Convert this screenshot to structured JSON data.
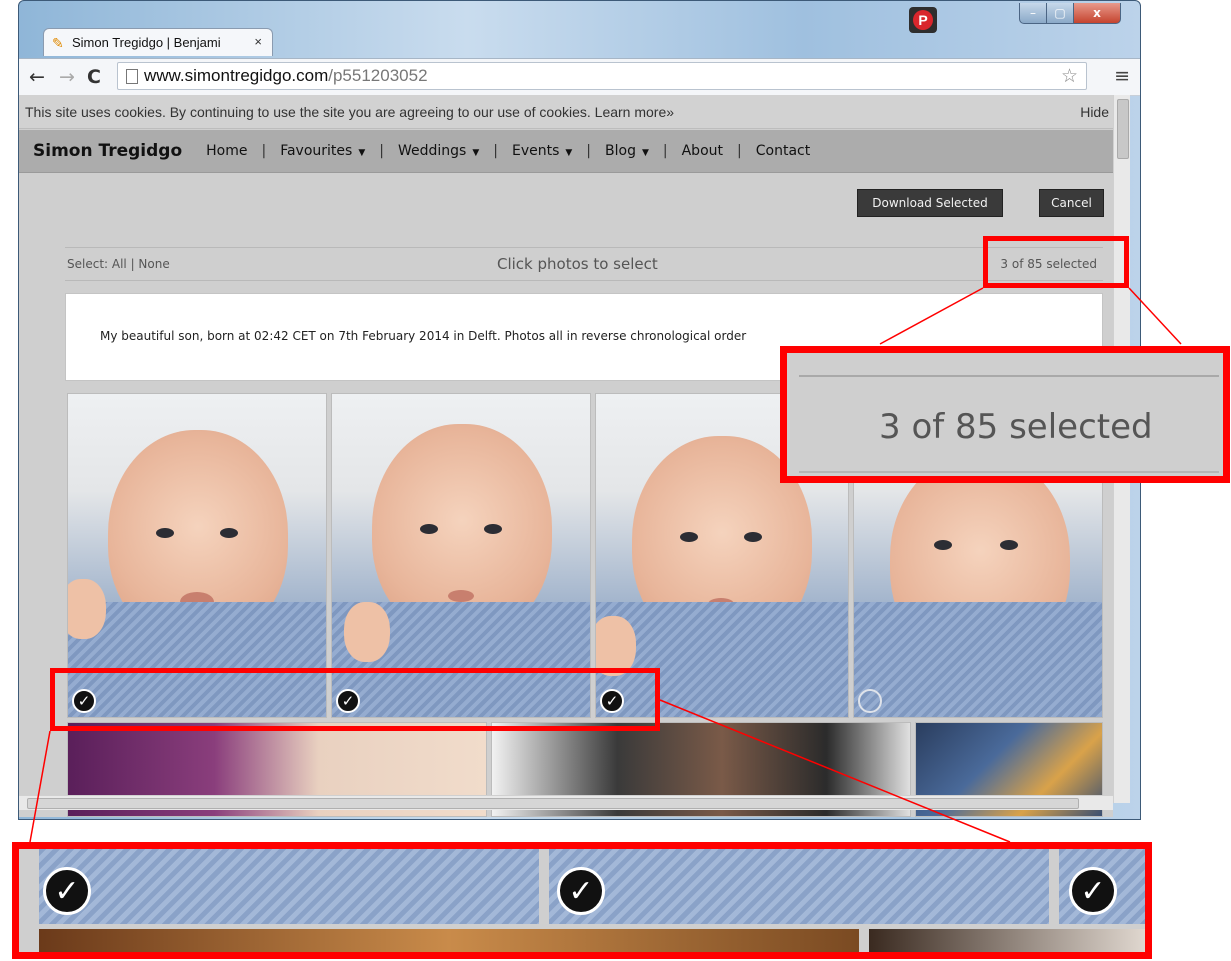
{
  "browser": {
    "tab_title": "Simon Tregidgo | Benjami",
    "tab_close": "×",
    "pin_badge": "P",
    "window_controls": {
      "minimize": "–",
      "maximize": "▢",
      "close": "x"
    },
    "nav": {
      "back": "←",
      "forward": "→",
      "reload": "C"
    },
    "url_host": "www.simontregidgo.com",
    "url_path": "/p551203052",
    "star": "☆",
    "menu": "≡"
  },
  "cookie_bar": {
    "text": "This site uses cookies. By continuing to use the site you are agreeing to our use of cookies. Learn more»",
    "hide": "Hide"
  },
  "site_nav": {
    "brand": "Simon Tregidgo",
    "items": [
      {
        "label": "Home"
      },
      {
        "label": "Favourites",
        "caret": "▼"
      },
      {
        "label": "Weddings",
        "caret": "▼"
      },
      {
        "label": "Events",
        "caret": "▼"
      },
      {
        "label": "Blog",
        "caret": "▼"
      },
      {
        "label": "About"
      },
      {
        "label": "Contact"
      }
    ],
    "separator": "|"
  },
  "actions": {
    "download": "Download Selected",
    "cancel": "Cancel"
  },
  "selection": {
    "select_all_none": "Select: All | None",
    "instruction": "Click photos to select",
    "count": "3 of 85 selected"
  },
  "gallery": {
    "description": "My beautiful son, born at 02:42 CET on 7th February 2014 in Delft. Photos all in reverse chronological order",
    "photos": [
      {
        "selected": true
      },
      {
        "selected": true
      },
      {
        "selected": true
      },
      {
        "selected": false
      }
    ],
    "check_glyph": "✓"
  },
  "zoom": {
    "count_text": "3 of 85 selected"
  },
  "colors": {
    "highlight": "#ff0000",
    "page_bg": "#cfcfcf",
    "nav_bg": "#acacac",
    "button_dark": "#3a3a3a"
  }
}
